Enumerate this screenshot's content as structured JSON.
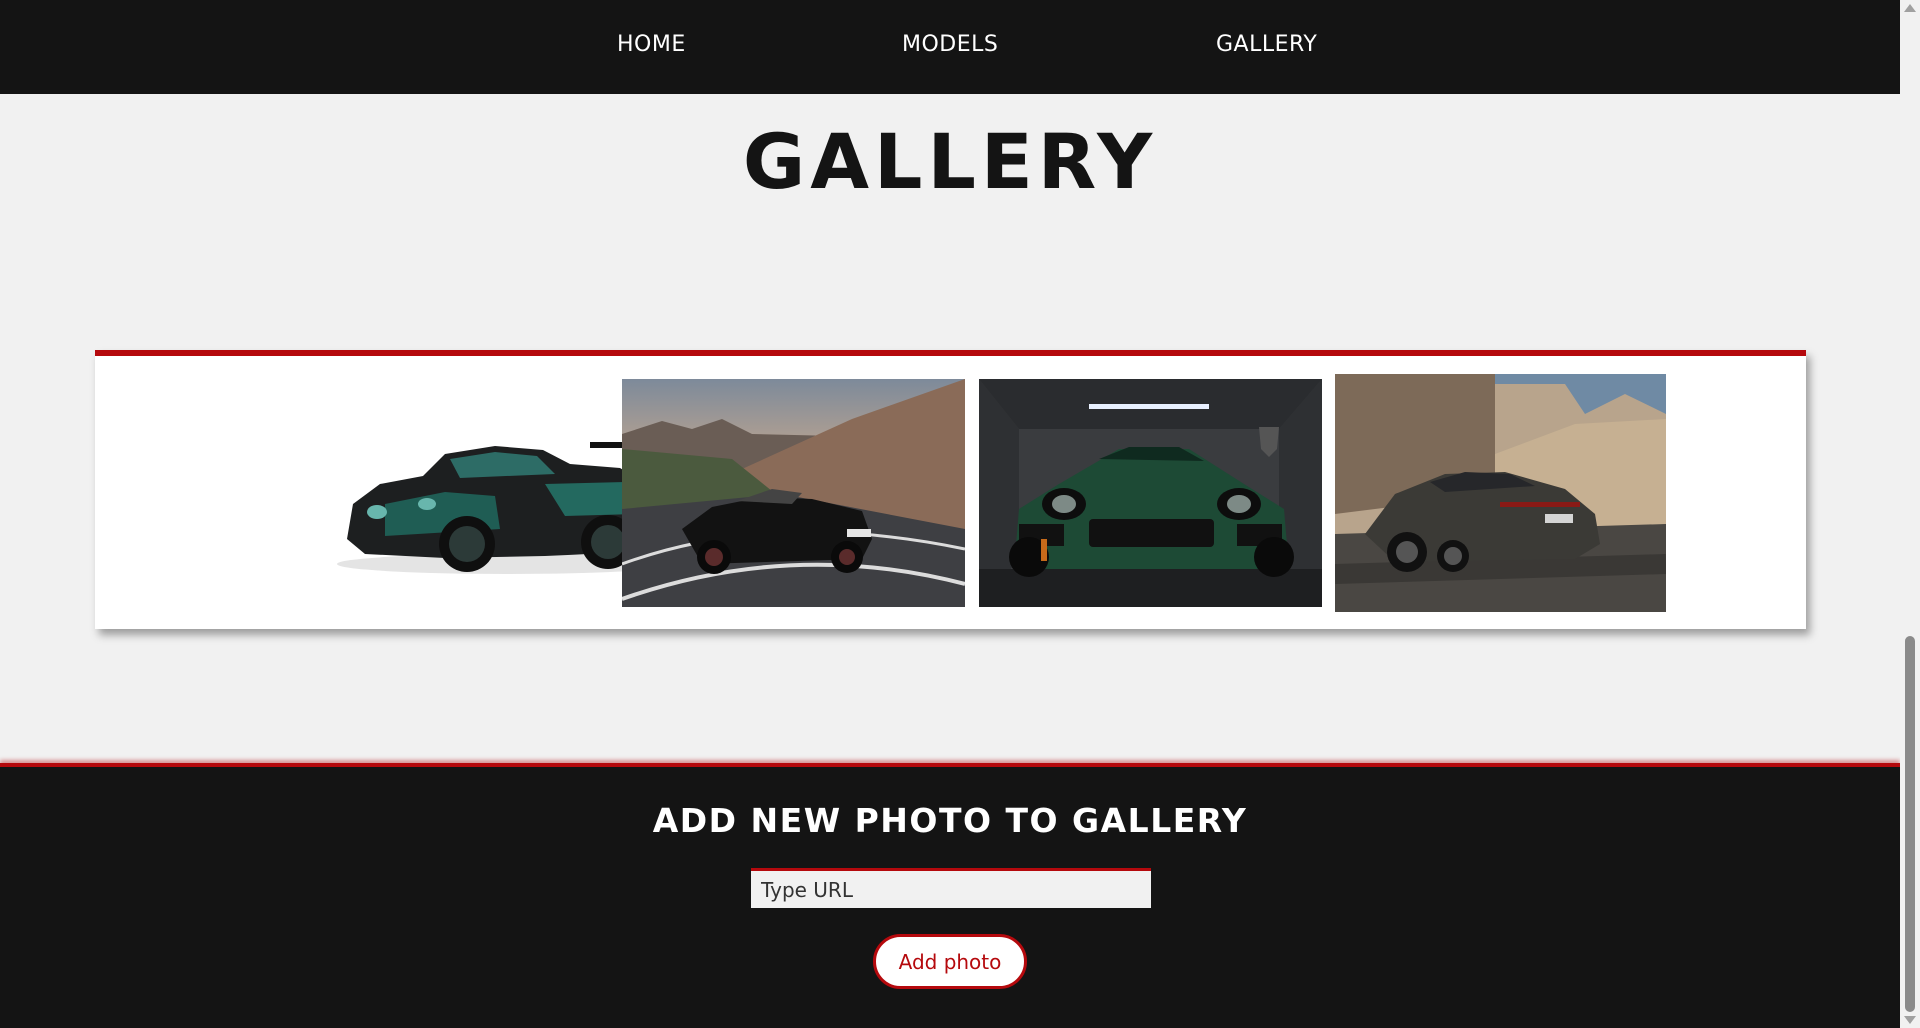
{
  "nav": {
    "home": "HOME",
    "models": "MODELS",
    "gallery": "GALLERY"
  },
  "page_title": "GALLERY",
  "gallery": {
    "photos": [
      {
        "subject": "dark green and black 911 GT2 RS with rear wing on white background"
      },
      {
        "subject": "black 911 cabriolet on mountain road at sunset"
      },
      {
        "subject": "green 911 turbo in concrete garage"
      },
      {
        "subject": "dark grey Panamera in front of beige wall"
      }
    ]
  },
  "footer": {
    "title": "ADD NEW PHOTO TO GALLERY",
    "url_placeholder": "Type URL",
    "add_button": "Add photo"
  },
  "colors": {
    "accent": "#b5090d",
    "dark": "#141414",
    "background": "#f1f1f1"
  }
}
